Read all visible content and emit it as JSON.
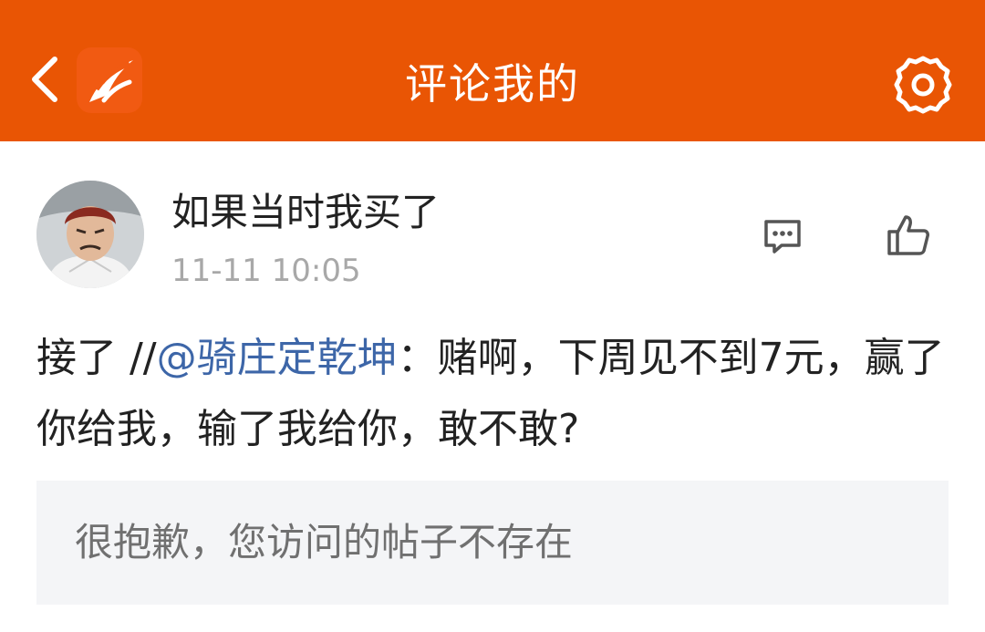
{
  "header": {
    "title": "评论我的",
    "background_color": "#E95504",
    "back_icon": "chevron-left-icon",
    "logo_icon": "app-logo-icon",
    "settings_icon": "gear-icon"
  },
  "comment": {
    "username": "如果当时我买了",
    "timestamp": "11-11 10:05",
    "text_prefix": "接了 //",
    "mention": "@骑庄定乾坤",
    "text_suffix": "：赌啊，下周见不到7元，赢了你给我，输了我给你，敢不敢?",
    "reply_icon": "comment-bubble-icon",
    "like_icon": "thumbs-up-icon",
    "mention_color": "#3D66A8"
  },
  "quoted_post": {
    "text": "很抱歉，您访问的帖子不存在"
  }
}
